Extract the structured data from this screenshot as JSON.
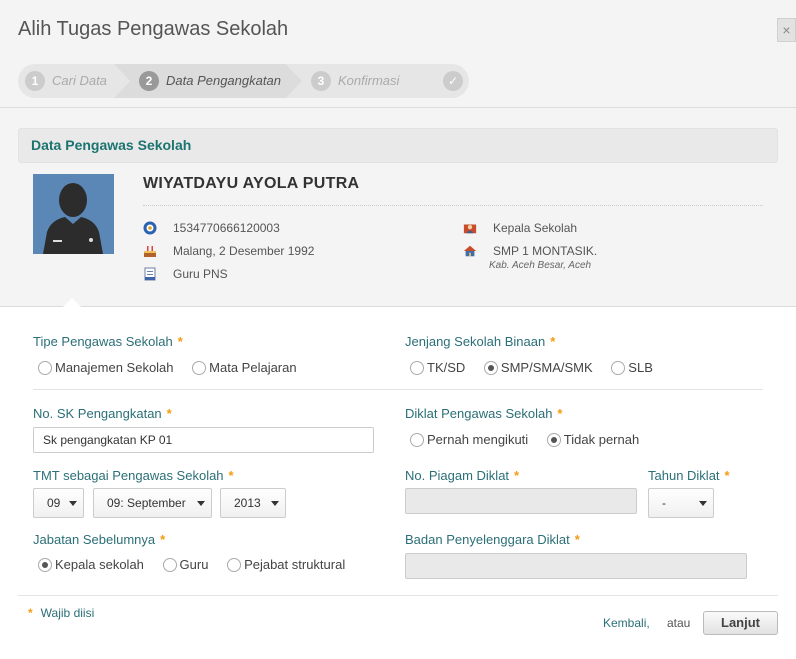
{
  "dialog": {
    "title": "Alih Tugas Pengawas Sekolah",
    "close_label": "×"
  },
  "wizard": {
    "steps": [
      {
        "num": "1",
        "label": "Cari Data",
        "active": false
      },
      {
        "num": "2",
        "label": "Data Pengangkatan",
        "active": true
      },
      {
        "num": "3",
        "label": "Konfirmasi",
        "active": false
      },
      {
        "num": "✓",
        "label": "",
        "active": false
      }
    ]
  },
  "profile": {
    "section_title": "Data Pengawas Sekolah",
    "name": "WIYATDAYU AYOLA PUTRA",
    "nip": "1534770666120003",
    "birth": "Malang, 2 Desember 1992",
    "status": "Guru PNS",
    "position": "Kepala Sekolah",
    "school": "SMP 1 MONTASIK.",
    "school_location": "Kab. Aceh Besar, Aceh"
  },
  "form": {
    "tipe": {
      "label": "Tipe Pengawas Sekolah",
      "options": [
        "Manajemen Sekolah",
        "Mata Pelajaran"
      ],
      "selected": null
    },
    "jenjang": {
      "label": "Jenjang Sekolah Binaan",
      "options": [
        "TK/SD",
        "SMP/SMA/SMK",
        "SLB"
      ],
      "selected": "SMP/SMA/SMK"
    },
    "no_sk": {
      "label": "No. SK Pengangkatan",
      "value": "Sk pengangkatan KP 01"
    },
    "diklat": {
      "label": "Diklat Pengawas Sekolah",
      "options": [
        "Pernah mengikuti",
        "Tidak pernah"
      ],
      "selected": "Tidak pernah"
    },
    "tmt": {
      "label": "TMT sebagai Pengawas Sekolah",
      "day": "09",
      "month": "09: September",
      "year": "2013"
    },
    "no_piagam": {
      "label": "No. Piagam Diklat",
      "value": ""
    },
    "tahun_diklat": {
      "label": "Tahun Diklat",
      "value": "-"
    },
    "jabatan": {
      "label": "Jabatan Sebelumnya",
      "options": [
        "Kepala sekolah",
        "Guru",
        "Pejabat struktural"
      ],
      "selected": "Kepala sekolah"
    },
    "badan": {
      "label": "Badan Penyelenggara Diklat",
      "value": ""
    },
    "required_mark": "*"
  },
  "footer": {
    "note": "Wajib diisi",
    "back": "Kembali,",
    "or": "atau",
    "next": "Lanjut"
  },
  "colors": {
    "accent": "#1c7370",
    "required": "#f39c12"
  }
}
